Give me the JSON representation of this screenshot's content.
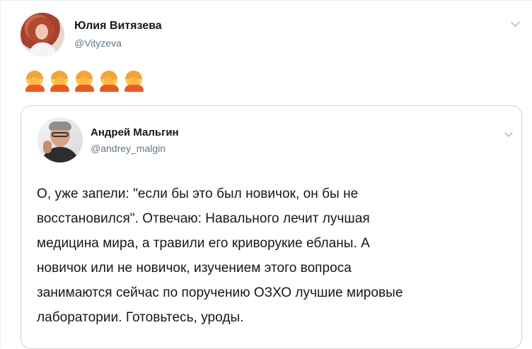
{
  "tweet": {
    "author_name": "Юлия Витязева",
    "author_handle": "@Vityzeva",
    "content_icon": "facepalm-emoji",
    "emoji_count": 5
  },
  "quoted_tweet": {
    "author_name": "Андрей Мальгин",
    "author_handle": "@andrey_malgin",
    "text": "О, уже запели: \"если бы это был новичок, он бы не\nвосстановился\". Отвечаю: Навального лечит лучшая\nмедицина мира, а травили его криворукие ебланы. А\nновичок или не новичок, изучением этого вопроса\nзанимаются сейчас по поручению ОЗХО лучшие мировые\nлаборатории. Готовьтесь, уроды."
  },
  "colors": {
    "text": "#14171a",
    "muted": "#657786",
    "border": "#ccd6dd"
  }
}
